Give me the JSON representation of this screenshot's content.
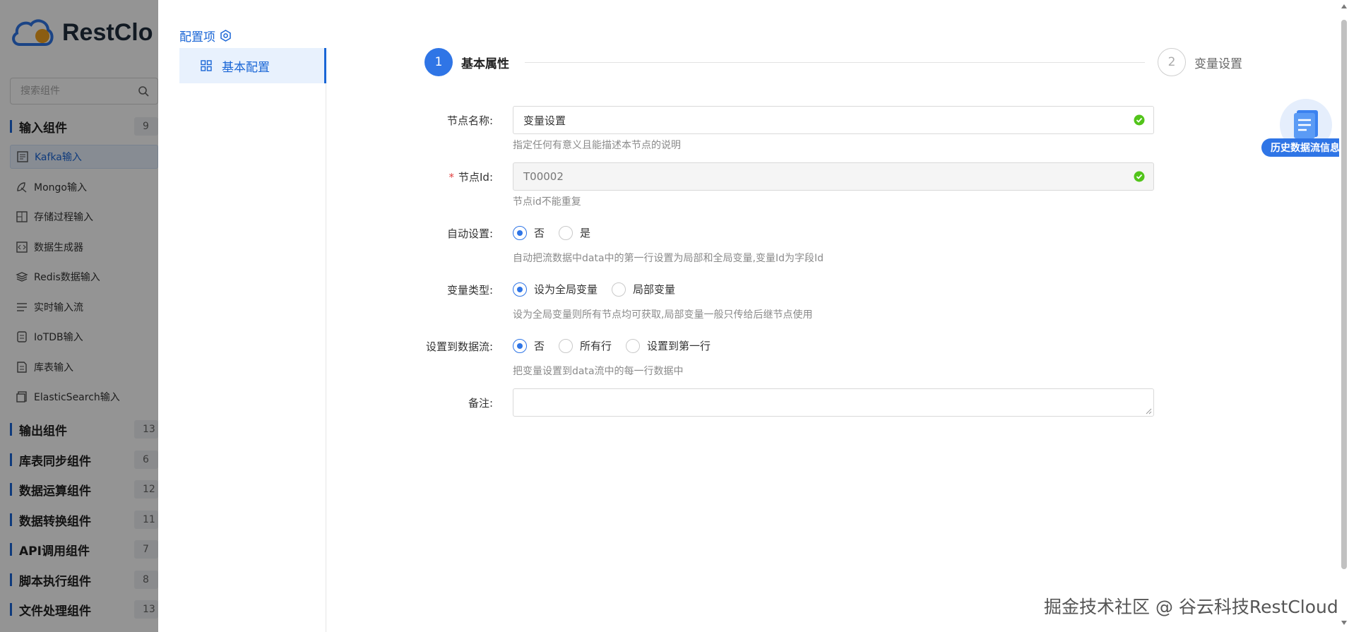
{
  "sidebar": {
    "logo_text": "RestClo",
    "search_placeholder": "搜索组件",
    "groups": [
      {
        "name": "输入组件",
        "count": "9"
      },
      {
        "name": "输出组件",
        "count": "13"
      },
      {
        "name": "库表同步组件",
        "count": "6"
      },
      {
        "name": "数据运算组件",
        "count": "12"
      },
      {
        "name": "数据转换组件",
        "count": "11"
      },
      {
        "name": "API调用组件",
        "count": "7"
      },
      {
        "name": "脚本执行组件",
        "count": "8"
      },
      {
        "name": "文件处理组件",
        "count": "13"
      }
    ],
    "input_items": [
      {
        "label": "Kafka输入"
      },
      {
        "label": "Mongo输入"
      },
      {
        "label": "存储过程输入"
      },
      {
        "label": "数据生成器"
      },
      {
        "label": "Redis数据输入"
      },
      {
        "label": "实时输入流"
      },
      {
        "label": "IoTDB输入"
      },
      {
        "label": "库表输入"
      },
      {
        "label": "ElasticSearch输入"
      }
    ]
  },
  "drawer": {
    "config_title": "配置项",
    "menu_item": "基本配置",
    "steps": [
      {
        "number": "1",
        "label": "基本属性"
      },
      {
        "number": "2",
        "label": "变量设置"
      }
    ],
    "form": {
      "node_name": {
        "label": "节点名称:",
        "value": "变量设置",
        "hint": "指定任何有意义且能描述本节点的说明"
      },
      "node_id": {
        "required_mark": "*",
        "label": "节点Id:",
        "value": "T00002",
        "hint": "节点id不能重复"
      },
      "auto_setting": {
        "label": "自动设置:",
        "options": [
          "否",
          "是"
        ],
        "selected": "否",
        "hint": "自动把流数据中data中的第一行设置为局部和全局变量,变量Id为字段Id"
      },
      "var_type": {
        "label": "变量类型:",
        "options": [
          "设为全局变量",
          "局部变量"
        ],
        "selected": "设为全局变量",
        "hint": "设为全局变量则所有节点均可获取,局部变量一般只传给后继节点使用"
      },
      "to_stream": {
        "label": "设置到数据流:",
        "options": [
          "否",
          "所有行",
          "设置到第一行"
        ],
        "selected": "否",
        "hint": "把变量设置到data流中的每一行数据中"
      },
      "remark": {
        "label": "备注:",
        "value": ""
      }
    }
  },
  "history_button": "历史数据流信息",
  "watermark": "掘金技术社区 @ 谷云科技RestCloud",
  "colors": {
    "primary": "#2f75e6",
    "success": "#52c41a",
    "required": "#e04040"
  }
}
